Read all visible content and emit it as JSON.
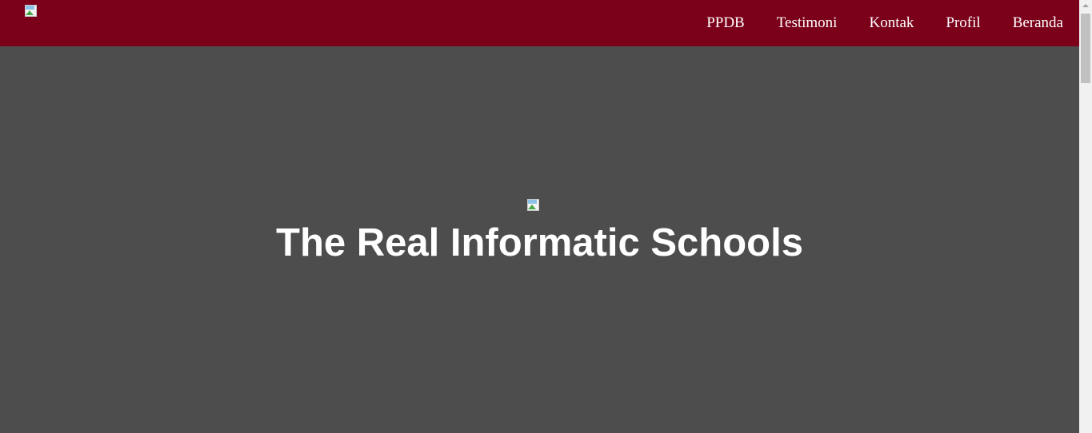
{
  "navbar": {
    "background": "#7b001a",
    "logo_icon": "broken-image-icon",
    "links": [
      {
        "label": "PPDB"
      },
      {
        "label": "Testimoni"
      },
      {
        "label": "Kontak"
      },
      {
        "label": "Profil"
      },
      {
        "label": "Beranda"
      }
    ]
  },
  "hero": {
    "background": "#4d4d4d",
    "image_icon": "broken-image-icon",
    "title": "The Real Informatic Schools"
  }
}
